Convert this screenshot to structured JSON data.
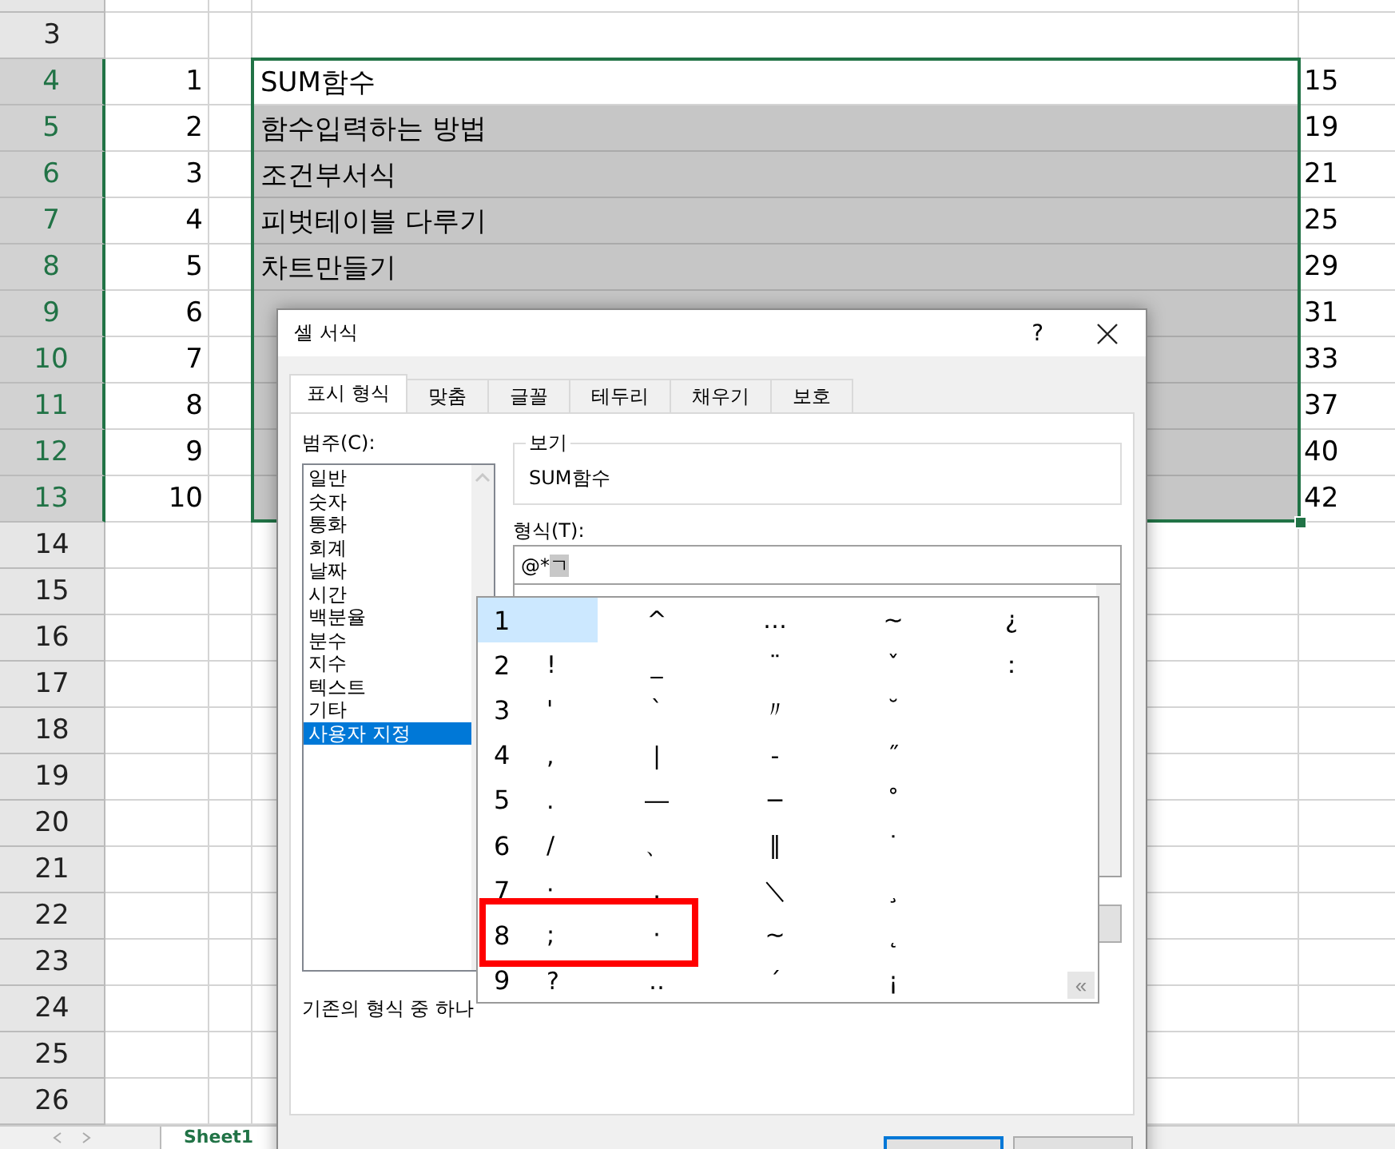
{
  "sheet": {
    "rows_above": [
      "3"
    ],
    "rows": [
      {
        "header": "4",
        "selected": true,
        "active": true,
        "number": "1",
        "title": "SUM함수",
        "page": "15"
      },
      {
        "header": "5",
        "selected": true,
        "active": false,
        "number": "2",
        "title": "함수입력하는 방법",
        "page": "19"
      },
      {
        "header": "6",
        "selected": true,
        "active": false,
        "number": "3",
        "title": "조건부서식",
        "page": "21"
      },
      {
        "header": "7",
        "selected": true,
        "active": false,
        "number": "4",
        "title": "피벗테이블 다루기",
        "page": "25"
      },
      {
        "header": "8",
        "selected": true,
        "active": false,
        "number": "5",
        "title": "차트만들기",
        "page": "29"
      },
      {
        "header": "9",
        "selected": true,
        "active": false,
        "number": "6",
        "page": "31"
      },
      {
        "header": "10",
        "selected": true,
        "active": false,
        "number": "7",
        "page": "33"
      },
      {
        "header": "11",
        "selected": true,
        "active": false,
        "number": "8",
        "page": "37"
      },
      {
        "header": "12",
        "selected": true,
        "active": false,
        "number": "9",
        "page": "40"
      },
      {
        "header": "13",
        "selected": true,
        "active": false,
        "number": "10",
        "page": "42"
      }
    ],
    "rows_below": [
      "14",
      "15",
      "16",
      "17",
      "18",
      "19",
      "20",
      "21",
      "22",
      "23",
      "24",
      "25",
      "26"
    ],
    "sheet_tabs": [
      {
        "label": "Sheet1",
        "selected": true
      }
    ]
  },
  "dialog": {
    "title": "셀 서식",
    "help": "?",
    "tabs": [
      {
        "label": "표시 형식",
        "selected": true
      },
      {
        "label": "맞춤",
        "selected": false
      },
      {
        "label": "글꼴",
        "selected": false
      },
      {
        "label": "테두리",
        "selected": false
      },
      {
        "label": "채우기",
        "selected": false
      },
      {
        "label": "보호",
        "selected": false
      }
    ],
    "category_label": "범주(C):",
    "categories": [
      {
        "label": "일반",
        "selected": false
      },
      {
        "label": "숫자",
        "selected": false
      },
      {
        "label": "통화",
        "selected": false
      },
      {
        "label": "회계",
        "selected": false
      },
      {
        "label": "날짜",
        "selected": false
      },
      {
        "label": "시간",
        "selected": false
      },
      {
        "label": "백분율",
        "selected": false
      },
      {
        "label": "분수",
        "selected": false
      },
      {
        "label": "지수",
        "selected": false
      },
      {
        "label": "텍스트",
        "selected": false
      },
      {
        "label": "기타",
        "selected": false
      },
      {
        "label": "사용자 지정",
        "selected": true
      }
    ],
    "preview_label": "보기",
    "preview": "SUM함수",
    "format_label": "형식(T):",
    "format_value": "@*",
    "format_composing": "ㄱ",
    "hint": "기존의 형식 중 하나"
  },
  "candidates": {
    "rows": [
      {
        "number": "1",
        "selected": true,
        "symbols": [
          "^",
          "…",
          "∼",
          "¿"
        ]
      },
      {
        "number": "2",
        "selected": false,
        "first": "!",
        "symbols": [
          "_",
          "¨",
          "ˇ",
          "："
        ]
      },
      {
        "number": "3",
        "selected": false,
        "first": "'",
        "symbols": [
          "`",
          "〃",
          "˘"
        ]
      },
      {
        "number": "4",
        "selected": false,
        "first": ",",
        "symbols": [
          "|",
          "-",
          "˝"
        ]
      },
      {
        "number": "5",
        "selected": false,
        "first": ".",
        "symbols": [
          "―",
          "─",
          "˚"
        ]
      },
      {
        "number": "6",
        "selected": false,
        "first": "/",
        "symbols": [
          "、",
          "‖",
          "˙"
        ]
      },
      {
        "number": "7",
        "selected": false,
        "first": "·",
        "symbols": [
          "．",
          "＼",
          "¸"
        ]
      },
      {
        "number": "8",
        "selected": false,
        "first": ";",
        "symbols": [
          "·",
          "∼",
          "˛"
        ]
      },
      {
        "number": "9",
        "selected": false,
        "first": "?",
        "symbols": [
          "‥",
          "´",
          "¡"
        ]
      }
    ],
    "expand": "«"
  }
}
